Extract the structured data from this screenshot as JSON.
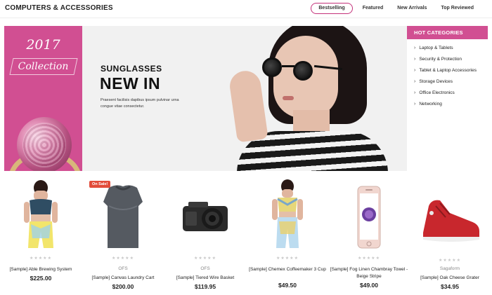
{
  "header": {
    "title": "COMPUTERS & ACCESSORIES",
    "tabs": [
      {
        "label": "Bestselling",
        "active": true
      },
      {
        "label": "Featured"
      },
      {
        "label": "New Arrivals"
      },
      {
        "label": "Top Reviewed"
      }
    ]
  },
  "promo": {
    "year": "2017",
    "label": "Collection",
    "color": "#d14f92"
  },
  "banner": {
    "kicker": "SUNGLASSES",
    "headline": "NEW IN",
    "description": "Praesent facilisis dapibus ipsum pulvinar urna congue vitae consectetur."
  },
  "categories": {
    "title": "HOT CATEGORIES",
    "items": [
      "Laptop & Tablets",
      "Security & Protection",
      "Tablet & Laptop Accessories",
      "Storage Devices",
      "Office Electronics",
      "Networking"
    ]
  },
  "products": [
    {
      "name": "[Sample] Able Brewing System",
      "brand": "",
      "price": "$225.00",
      "image": "sports-bra-model"
    },
    {
      "name": "[Sample] Canvas Laundry Cart",
      "brand": "OFS",
      "price": "$200.00",
      "badge": "On Sale!",
      "image": "compression-top"
    },
    {
      "name": "[Sample] Tiered Wire Basket",
      "brand": "OFS",
      "price": "$119.95",
      "image": "action-camera"
    },
    {
      "name": "[Sample] Chemex Coffeemaker 3 Cup",
      "brand": "",
      "price": "$49.50",
      "image": "fitness-outfit"
    },
    {
      "name": "[Sample] Fog Linen Chambray Towel - Beige Stripe",
      "brand": "",
      "price": "$49.00",
      "image": "smartphone"
    },
    {
      "name": "[Sample] Oak Cheese Grater",
      "brand": "Sagaform",
      "price": "$34.95",
      "image": "red-sneaker"
    }
  ],
  "colors": {
    "accent": "#d14f92",
    "sale_badge": "#e24c3a"
  }
}
